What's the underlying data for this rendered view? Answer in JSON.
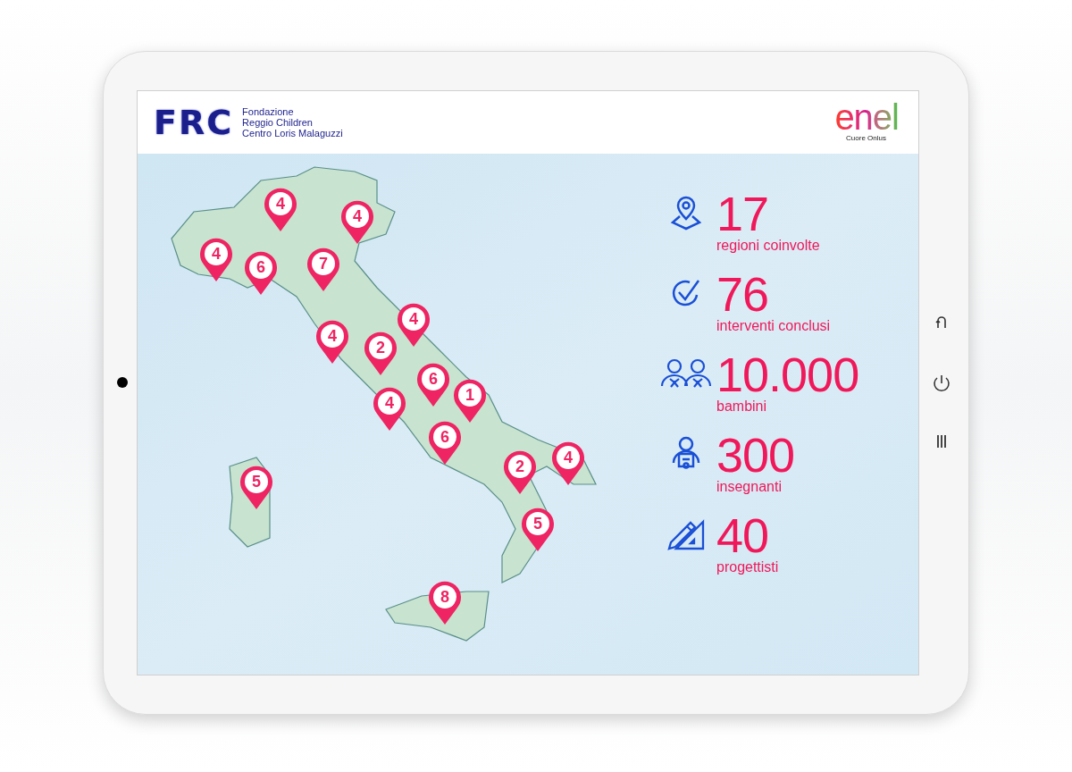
{
  "header": {
    "left_logo": {
      "mark": "FRC",
      "lines": [
        "Fondazione",
        "Reggio Children",
        "Centro Loris Malaguzzi"
      ]
    },
    "right_logo": {
      "mark": "enel",
      "subtitle": "Cuore Onlus"
    }
  },
  "map": {
    "pins": [
      {
        "label": "4"
      },
      {
        "label": "4"
      },
      {
        "label": "4"
      },
      {
        "label": "6"
      },
      {
        "label": "7"
      },
      {
        "label": "4"
      },
      {
        "label": "2"
      },
      {
        "label": "4"
      },
      {
        "label": "6"
      },
      {
        "label": "4"
      },
      {
        "label": "1"
      },
      {
        "label": "6"
      },
      {
        "label": "2"
      },
      {
        "label": "4"
      },
      {
        "label": "5"
      },
      {
        "label": "5"
      },
      {
        "label": "8"
      }
    ]
  },
  "stats": [
    {
      "kind": "regions",
      "value": "17",
      "label": "regioni coinvolte"
    },
    {
      "kind": "done",
      "value": "76",
      "label": "interventi conclusi"
    },
    {
      "kind": "children",
      "value": "10.000",
      "label": "bambini"
    },
    {
      "kind": "teachers",
      "value": "300",
      "label": "insegnanti"
    },
    {
      "kind": "designers",
      "value": "40",
      "label": "progettisti"
    }
  ]
}
